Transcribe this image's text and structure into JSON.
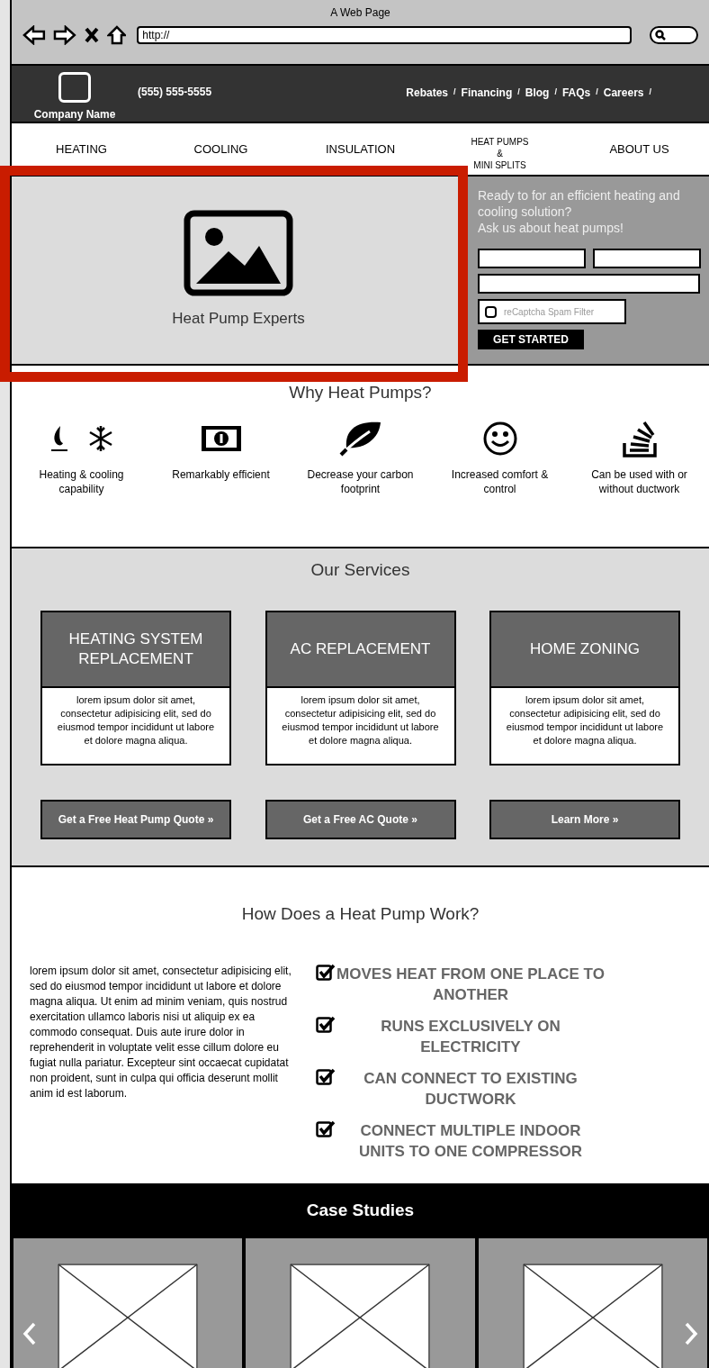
{
  "window": {
    "title": "A Web Page",
    "url": "http://"
  },
  "header": {
    "logo_caption": "Company Name",
    "phone": "(555) 555-5555",
    "links": [
      "Rebates",
      "Financing",
      "Blog",
      "FAQs",
      "Careers"
    ],
    "separator": "/"
  },
  "nav": [
    {
      "label": "HEATING"
    },
    {
      "label": "COOLING"
    },
    {
      "label": "INSULATION"
    },
    {
      "label": "HEAT PUMPS\n&\nMINI SPLITS"
    },
    {
      "label": "ABOUT US"
    }
  ],
  "hero": {
    "caption": "Heat Pump Experts",
    "highlighted": true,
    "form": {
      "intro": "Ready to for an efficient heating and cooling solution?\nAsk us about heat pumps!",
      "captcha": {
        "label": "reCaptcha Spam Filter",
        "checked": false
      },
      "button": "GET STARTED"
    }
  },
  "why": {
    "title": "Why Heat Pumps?",
    "features": [
      {
        "kind": "flame-snow",
        "label": "Heating & cooling capability"
      },
      {
        "kind": "money",
        "label": "Remarkably efficient"
      },
      {
        "kind": "leaf",
        "label": "Decrease your carbon footprint"
      },
      {
        "kind": "smile",
        "label": "Increased comfort & control"
      },
      {
        "kind": "stack",
        "label": "Can be used with or without ductwork"
      }
    ]
  },
  "services": {
    "title": "Our Services",
    "cards": [
      {
        "title": "HEATING SYSTEM REPLACEMENT",
        "body": "lorem ipsum dolor sit amet, consectetur adipisicing elit, sed do eiusmod tempor incididunt ut labore et dolore magna aliqua.",
        "button": "Get a Free Heat Pump Quote »"
      },
      {
        "title": "AC REPLACEMENT",
        "body": "lorem ipsum dolor sit amet, consectetur adipisicing elit, sed do eiusmod tempor incididunt ut labore et dolore magna aliqua.",
        "button": "Get a Free AC Quote »"
      },
      {
        "title": "HOME ZONING",
        "body": "lorem ipsum dolor sit amet, consectetur adipisicing elit, sed do eiusmod tempor incididunt ut labore et dolore magna aliqua.",
        "button": "Learn More »"
      }
    ]
  },
  "how": {
    "title": "How Does a Heat Pump Work?",
    "body": "lorem ipsum dolor sit amet, consectetur adipisicing elit, sed do eiusmod tempor incididunt ut labore et dolore magna aliqua. Ut enim ad minim veniam, quis nostrud exercitation ullamco laboris nisi ut aliquip ex ea commodo consequat. Duis aute irure dolor in reprehenderit in voluptate velit esse cillum dolore eu fugiat nulla pariatur. Excepteur sint occaecat cupidatat non proident, sunt in culpa qui officia deserunt mollit anim id est laborum.",
    "checklist": [
      {
        "label": "MOVES HEAT FROM ONE PLACE TO ANOTHER",
        "checked": true
      },
      {
        "label": "RUNS EXCLUSIVELY ON ELECTRICITY",
        "checked": true
      },
      {
        "label": "CAN CONNECT TO EXISTING DUCTWORK",
        "checked": true
      },
      {
        "label": "CONNECT MULTIPLE INDOOR UNITS TO ONE COMPRESSOR",
        "checked": true
      }
    ]
  },
  "case_studies": {
    "title": "Case Studies",
    "slides": [
      {
        "kind": "placeholder"
      },
      {
        "kind": "placeholder"
      },
      {
        "kind": "placeholder"
      }
    ]
  }
}
